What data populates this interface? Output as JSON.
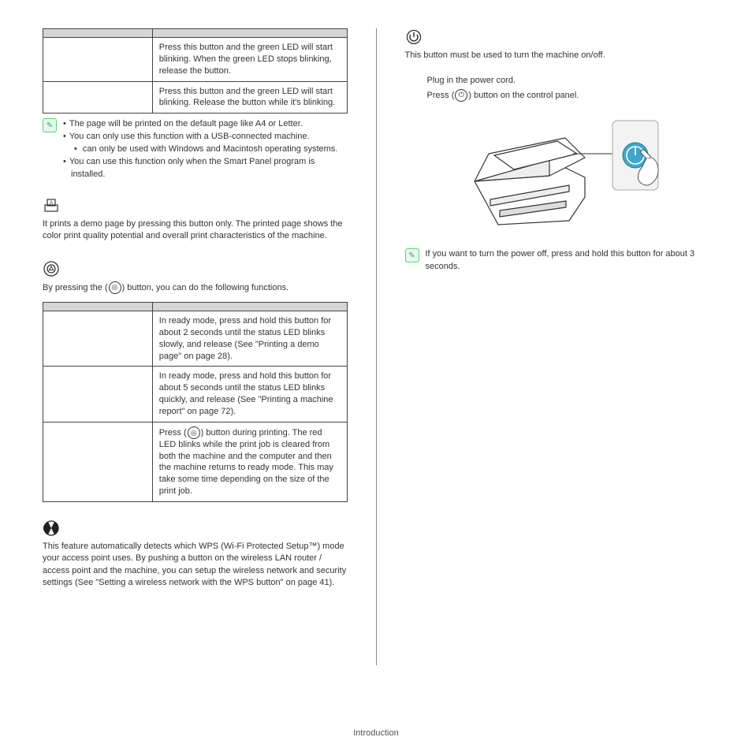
{
  "footer": {
    "text": "Introduction"
  },
  "left": {
    "table1": {
      "header_col1": "",
      "header_col2": "",
      "rows": [
        {
          "c1": "",
          "c2": "Press this button and the green LED will start blinking. When the green LED stops blinking, release the button."
        },
        {
          "c1": "",
          "c2": "Press this button and the green LED will start blinking. Release the button while it's blinking."
        }
      ]
    },
    "notes1": [
      "The page will be printed on the default page like A4 or Letter.",
      "You can only use this function with a USB-connected machine."
    ],
    "notes1_indent_suffix": " can only be used with Windows and Macintosh operating systems.",
    "notes1_after": "You can use this function only when the Smart Panel program is installed.",
    "demo_para": "It prints a demo page by pressing this button only. The printed page shows the color print quality potential and overall print characteristics of the machine.",
    "cancel_line_before": "By pressing the ",
    "cancel_line_after": " button, you can do the following functions.",
    "table2": {
      "header_col1": "",
      "header_col2": "",
      "rows": [
        {
          "c1": "",
          "c2": "In ready mode, press and hold this button for about 2 seconds until the status LED blinks slowly, and release (See \"Printing a demo page\" on page 28)."
        },
        {
          "c1": "",
          "c2": "In ready mode, press and hold this button for about 5 seconds until the status LED blinks quickly, and release (See \"Printing a machine report\" on page 72)."
        }
      ],
      "row3_prefix": "Press ",
      "row3_suffix": " button during printing. The red LED blinks while the print job is cleared from both the machine and the computer and then the machine returns to ready mode. This may take some time depending on the size of the print job."
    },
    "wps_para": "This feature automatically detects which WPS (Wi-Fi Protected Setup™) mode your access point uses. By pushing a button on the wireless LAN router / access point and the machine, you can setup the wireless network and security settings (See \"Setting a wireless network with the WPS button\" on page 41)."
  },
  "right": {
    "power_intro": "This button must be used to turn the machine on/off.",
    "step1": "Plug in the power cord.",
    "step2_before": "Press ",
    "step2_after": " button on the control panel.",
    "power_note": "If you want to turn the power off, press and hold this button for about 3 seconds."
  },
  "icons": {
    "cancel": "◎",
    "power": "⏻"
  }
}
